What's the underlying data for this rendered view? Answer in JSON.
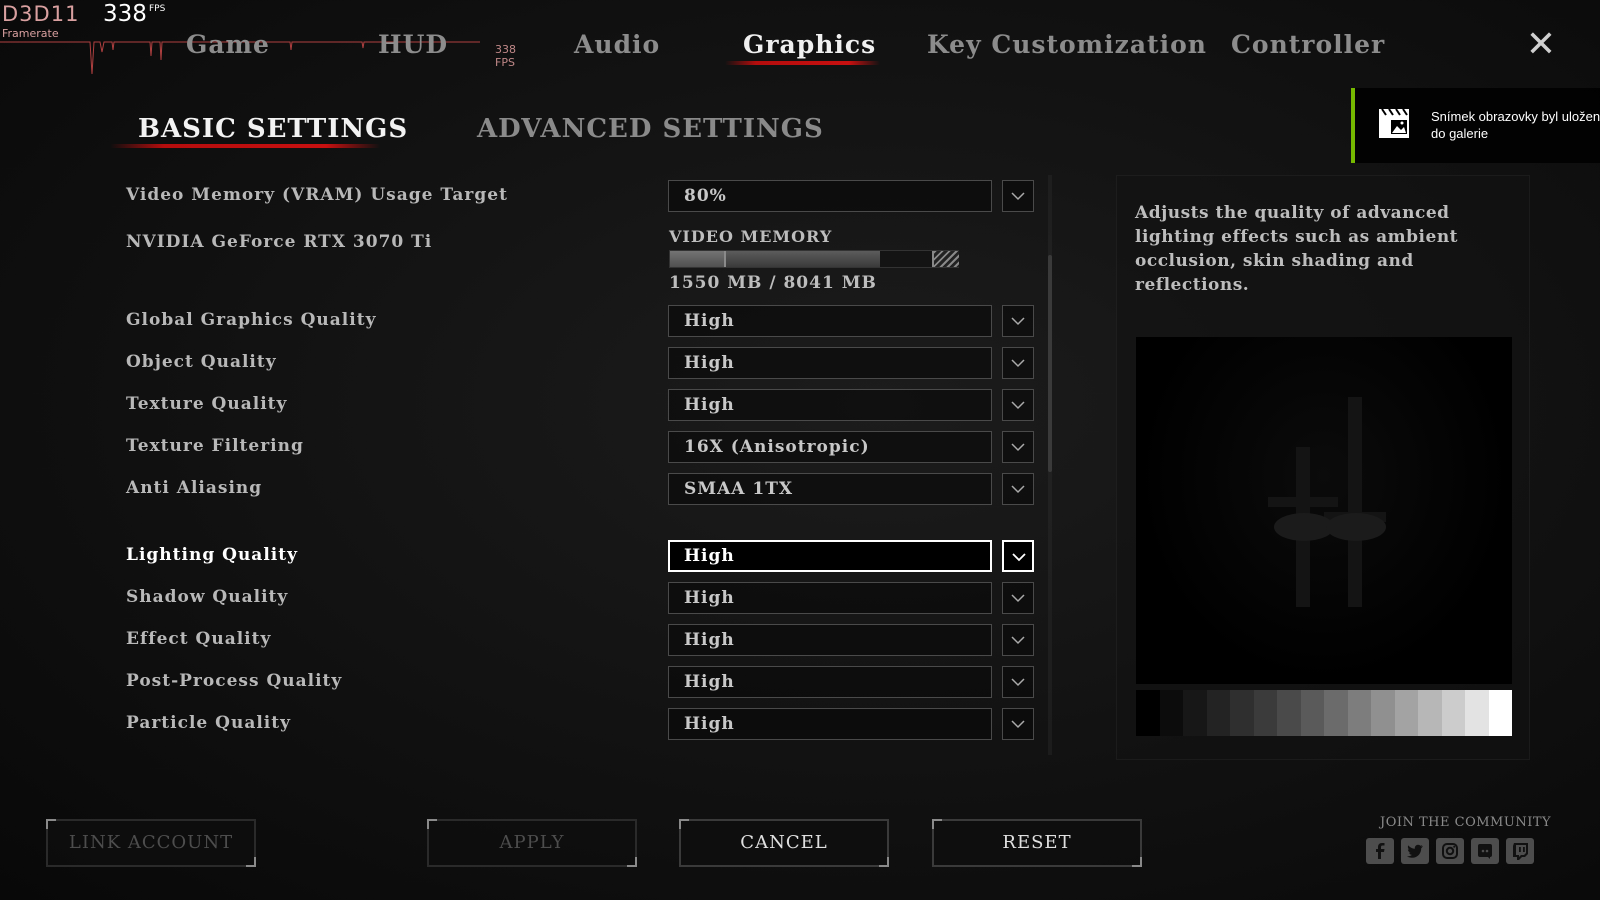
{
  "overlay": {
    "api": "D3D11",
    "fps": "338",
    "fps_unit": "FPS",
    "framerate_label": "Framerate",
    "fps_small": "338 FPS"
  },
  "top_tabs": [
    "Game",
    "HUD",
    "Audio",
    "Graphics",
    "Key Customization",
    "Controller"
  ],
  "active_top_tab": "Graphics",
  "sub_tabs": [
    "BASIC SETTINGS",
    "ADVANCED SETTINGS"
  ],
  "active_sub_tab": "BASIC SETTINGS",
  "notification": {
    "text": "Snímek obrazovky byl uložen do galerie",
    "accent": "#76b900"
  },
  "vram_target": {
    "label": "Video Memory (VRAM) Usage Target",
    "value": "80%"
  },
  "gpu": {
    "name": "NVIDIA GeForce RTX 3070 Ti",
    "memory_label": "VIDEO MEMORY",
    "memory_value": "1550 MB / 8041 MB",
    "used_fraction": 0.193
  },
  "settings": [
    {
      "label": "Global Graphics Quality",
      "value": "High",
      "selected": false
    },
    {
      "label": "Object Quality",
      "value": "High",
      "selected": false
    },
    {
      "label": "Texture Quality",
      "value": "High",
      "selected": false
    },
    {
      "label": "Texture Filtering",
      "value": "16X (Anisotropic)",
      "selected": false
    },
    {
      "label": "Anti Aliasing",
      "value": "SMAA 1TX",
      "selected": false
    },
    {
      "label": "Lighting Quality",
      "value": "High",
      "selected": true
    },
    {
      "label": "Shadow Quality",
      "value": "High",
      "selected": false
    },
    {
      "label": "Effect Quality",
      "value": "High",
      "selected": false
    },
    {
      "label": "Post-Process Quality",
      "value": "High",
      "selected": false
    },
    {
      "label": "Particle Quality",
      "value": "High",
      "selected": false
    }
  ],
  "description": "Adjusts the quality of advanced lighting effects such as ambient occlusion, skin shading and reflections.",
  "buttons": {
    "link_account": "LINK ACCOUNT",
    "apply": "APPLY",
    "cancel": "CANCEL",
    "reset": "RESET"
  },
  "community": {
    "label": "JOIN THE COMMUNITY",
    "icons": [
      "facebook-icon",
      "twitter-icon",
      "instagram-icon",
      "discord-icon",
      "twitch-icon"
    ]
  },
  "colors": {
    "accent_red": "#c81010",
    "nvidia_green": "#76b900"
  }
}
